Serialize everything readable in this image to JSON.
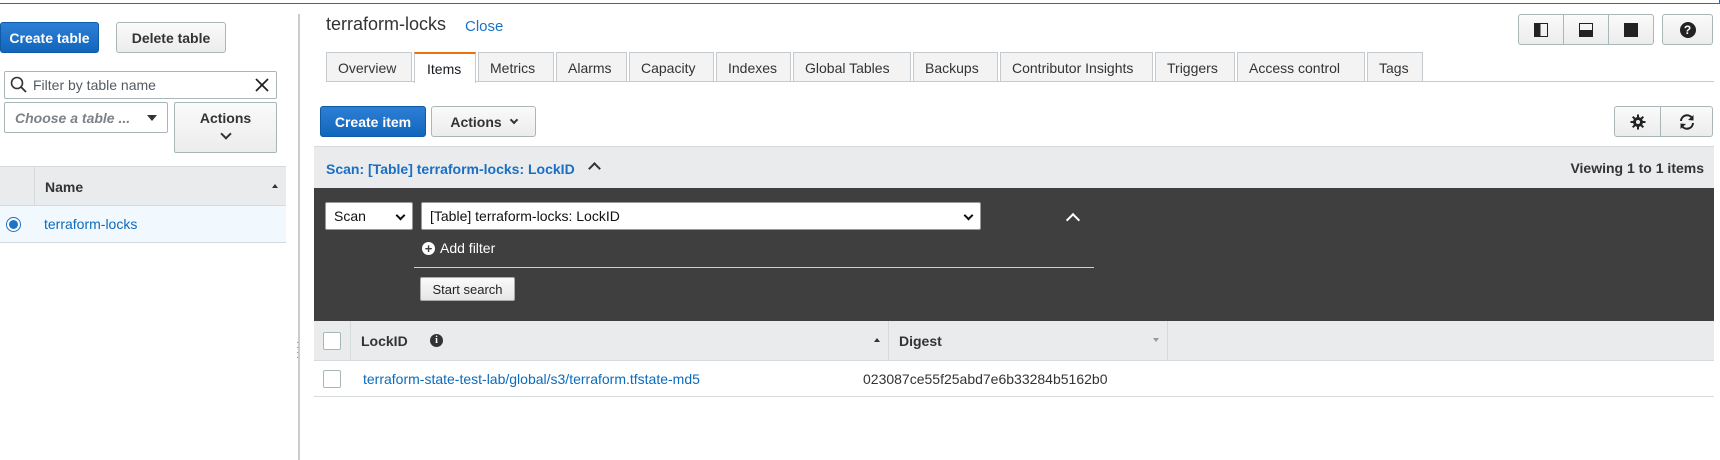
{
  "left_panel": {
    "create_table": "Create table",
    "delete_table": "Delete table",
    "filter_placeholder": "Filter by table name",
    "choose_table": "Choose a table ...",
    "actions": "Actions",
    "column_name": "Name",
    "tables": [
      {
        "name": "terraform-locks",
        "selected": true
      }
    ]
  },
  "header": {
    "title": "terraform-locks",
    "close": "Close"
  },
  "tabs": [
    {
      "label": "Overview",
      "active": false
    },
    {
      "label": "Items",
      "active": true
    },
    {
      "label": "Metrics",
      "active": false
    },
    {
      "label": "Alarms",
      "active": false
    },
    {
      "label": "Capacity",
      "active": false
    },
    {
      "label": "Indexes",
      "active": false
    },
    {
      "label": "Global Tables",
      "active": false
    },
    {
      "label": "Backups",
      "active": false
    },
    {
      "label": "Contributor Insights",
      "active": false
    },
    {
      "label": "Triggers",
      "active": false
    },
    {
      "label": "Access control",
      "active": false
    },
    {
      "label": "Tags",
      "active": false
    }
  ],
  "toolbar": {
    "create_item": "Create item",
    "actions": "Actions"
  },
  "scan": {
    "title": "Scan: [Table] terraform-locks: LockID",
    "viewing": "Viewing 1 to 1 items",
    "mode": "Scan",
    "target": "[Table] terraform-locks: LockID",
    "add_filter": "Add filter",
    "start_search": "Start search"
  },
  "items_table": {
    "columns": [
      "LockID",
      "Digest"
    ],
    "rows": [
      {
        "lockid": "terraform-state-test-lab/global/s3/terraform.tfstate-md5",
        "digest": "023087ce55f25abd7e6b33284b5162b0"
      }
    ]
  },
  "colors": {
    "primary": "#1166bb",
    "link": "#0b6bbd",
    "active_tab": "#ec7211",
    "dark_panel": "#3f3f3f"
  }
}
